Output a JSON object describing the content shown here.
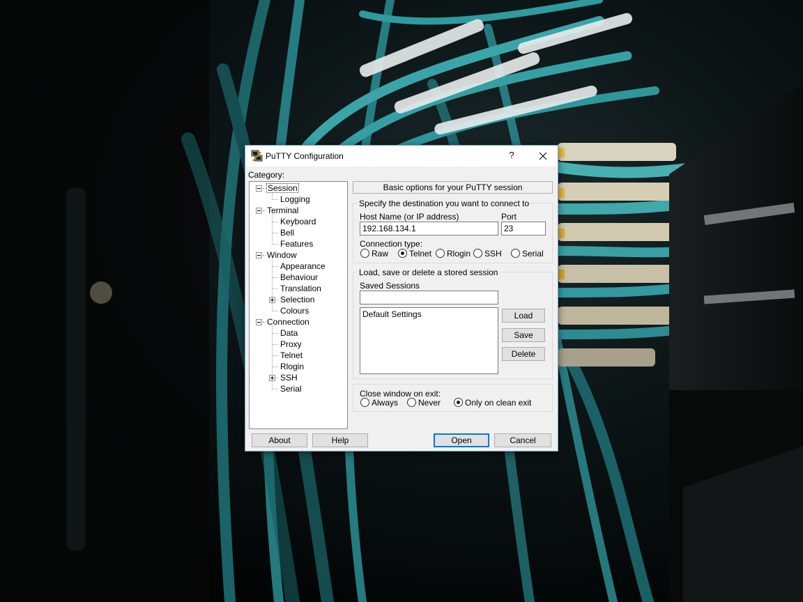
{
  "window": {
    "title": "PuTTY Configuration",
    "help_glyph": "?",
    "close_glyph": "✕"
  },
  "category": {
    "label": "Category:",
    "tree": [
      {
        "label": "Session",
        "level": 0,
        "expander": "minus",
        "selected": true
      },
      {
        "label": "Logging",
        "level": 1
      },
      {
        "label": "Terminal",
        "level": 0,
        "expander": "minus"
      },
      {
        "label": "Keyboard",
        "level": 1
      },
      {
        "label": "Bell",
        "level": 1
      },
      {
        "label": "Features",
        "level": 1
      },
      {
        "label": "Window",
        "level": 0,
        "expander": "minus"
      },
      {
        "label": "Appearance",
        "level": 1
      },
      {
        "label": "Behaviour",
        "level": 1
      },
      {
        "label": "Translation",
        "level": 1
      },
      {
        "label": "Selection",
        "level": 1,
        "expander": "plus"
      },
      {
        "label": "Colours",
        "level": 1
      },
      {
        "label": "Connection",
        "level": 0,
        "expander": "minus"
      },
      {
        "label": "Data",
        "level": 1
      },
      {
        "label": "Proxy",
        "level": 1
      },
      {
        "label": "Telnet",
        "level": 1
      },
      {
        "label": "Rlogin",
        "level": 1
      },
      {
        "label": "SSH",
        "level": 1,
        "expander": "plus"
      },
      {
        "label": "Serial",
        "level": 1
      }
    ]
  },
  "panel": {
    "header": "Basic options for your PuTTY session",
    "destination": {
      "group_label": "Specify the destination you want to connect to",
      "host_label": "Host Name (or IP address)",
      "host_value": "192.168.134.1",
      "port_label": "Port",
      "port_value": "23",
      "conn_type_label": "Connection type:",
      "conn_types": [
        {
          "label": "Raw",
          "checked": false
        },
        {
          "label": "Telnet",
          "checked": true
        },
        {
          "label": "Rlogin",
          "checked": false
        },
        {
          "label": "SSH",
          "checked": false
        },
        {
          "label": "Serial",
          "checked": false
        }
      ]
    },
    "sessions": {
      "group_label": "Load, save or delete a stored session",
      "saved_label": "Saved Sessions",
      "saved_value": "",
      "list": [
        "Default Settings"
      ],
      "load_label": "Load",
      "save_label": "Save",
      "delete_label": "Delete"
    },
    "close_on_exit": {
      "label": "Close window on exit:",
      "options": [
        {
          "label": "Always",
          "checked": false
        },
        {
          "label": "Never",
          "checked": false
        },
        {
          "label": "Only on clean exit",
          "checked": true
        }
      ]
    }
  },
  "footer": {
    "about": "About",
    "help": "Help",
    "open": "Open",
    "cancel": "Cancel"
  },
  "colors": {
    "dialog_bg": "#f0f0f0",
    "default_button_border": "#0078d7",
    "wallpaper_cable": "#2a8f95"
  }
}
